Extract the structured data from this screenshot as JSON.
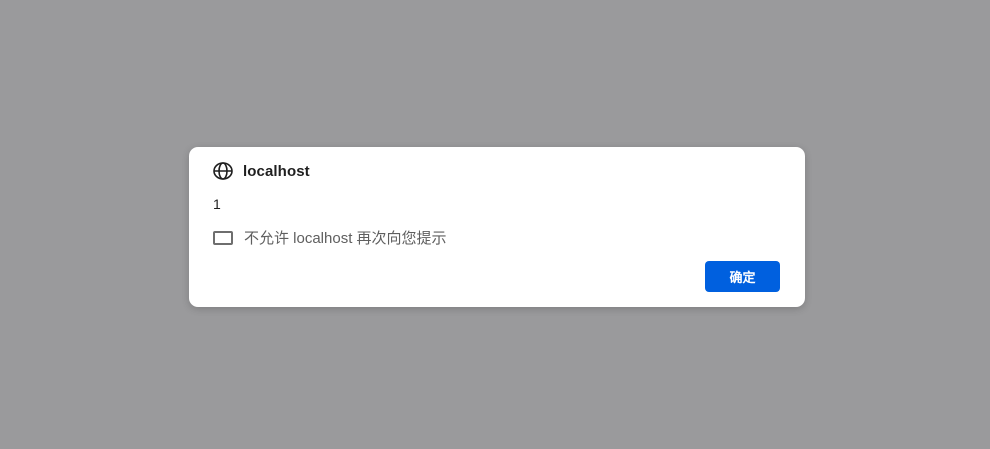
{
  "dialog": {
    "title": "localhost",
    "title_icon": "globe-icon",
    "message": "1",
    "checkbox": {
      "label": "不允许 localhost 再次向您提示",
      "checked": false
    },
    "ok_button_label": "确定"
  },
  "colors": {
    "overlay": "#9a9a9c",
    "dialog_bg": "#ffffff",
    "primary_button": "#0060df",
    "title_text": "#1f1f1f",
    "secondary_text": "#5f5f5f"
  }
}
